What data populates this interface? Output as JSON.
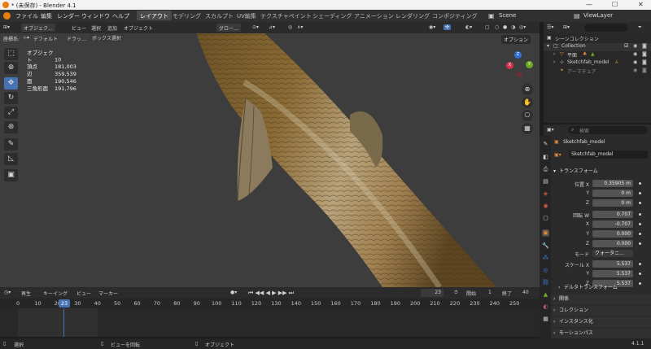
{
  "window": {
    "title": "* (未保存) - Blender 4.1",
    "minimize": "—",
    "maximize": "☐",
    "close": "✕"
  },
  "menu": {
    "items": [
      "ファイル",
      "編集",
      "レンダー",
      "ウィンドウ",
      "ヘルプ"
    ],
    "workspaces": [
      "レイアウト",
      "モデリング",
      "スカルプト",
      "UV編集",
      "テクスチャペイント",
      "シェーディング",
      "アニメーション",
      "レンダリング",
      "コンポジティング"
    ],
    "scene": "Scene",
    "view_layer": "ViewLayer"
  },
  "viewport_header": {
    "mode": "オブジェク…",
    "view": "ビュー",
    "select": "選択",
    "add": "追加",
    "object": "オブジェクト",
    "orientation": "グロー…",
    "coord_label": "座標系:",
    "coord_value": "デフォルト",
    "drag_label": "ドラッ…",
    "select_mode": "ボックス選択",
    "options": "オプション"
  },
  "stats": [
    {
      "label": "オブジェクト",
      "value": "10"
    },
    {
      "label": "頂点",
      "value": "181,003"
    },
    {
      "label": "辺",
      "value": "359,539"
    },
    {
      "label": "面",
      "value": "190,546"
    },
    {
      "label": "三角形面",
      "value": "191,796"
    }
  ],
  "gizmo": {
    "x": "X",
    "y": "Y",
    "z": "Z"
  },
  "timeline": {
    "playback": "再生",
    "keying": "キーイング",
    "view": "ビュー",
    "marker": "マーカー",
    "current_frame": "23",
    "start_label": "開始",
    "start": "1",
    "end_label": "終了",
    "end": "40",
    "ticks": [
      "0",
      "10",
      "20",
      "30",
      "40",
      "50",
      "60",
      "70",
      "80",
      "90",
      "100",
      "110",
      "120",
      "130",
      "140",
      "150",
      "160",
      "170",
      "180",
      "190",
      "200",
      "210",
      "220",
      "230",
      "240",
      "250"
    ]
  },
  "status": {
    "select": "選択",
    "rotate": "ビューを回転",
    "object": "オブジェクト",
    "version": "4.1.1"
  },
  "outliner": {
    "title": "シーンコレクション",
    "rows": [
      "Collection",
      "平面",
      "Sketchfab_model",
      "アーマチュア"
    ]
  },
  "properties": {
    "search_placeholder": "検索",
    "object_name": "Sketchfab_model",
    "data_name": "Sketchfab_model",
    "transform_title": "トランスフォーム",
    "location_label": "位置 X",
    "location": [
      "0.35905 m",
      "0 m",
      "0 m"
    ],
    "rotation_label": "回転 W",
    "rotation": [
      "0.707",
      "-0.707",
      "0.000",
      "0.000"
    ],
    "mode_label": "モード",
    "mode_value": "クォータニ…",
    "scale_label": "スケール X",
    "scale": [
      "5.537",
      "5.537",
      "5.537"
    ],
    "axis_y": "Y",
    "axis_z": "Z",
    "axis_x": "X",
    "delta": "デルタトランスフォーム",
    "panels": [
      "関係",
      "コレクション",
      "インスタンス化",
      "モーションパス"
    ]
  }
}
